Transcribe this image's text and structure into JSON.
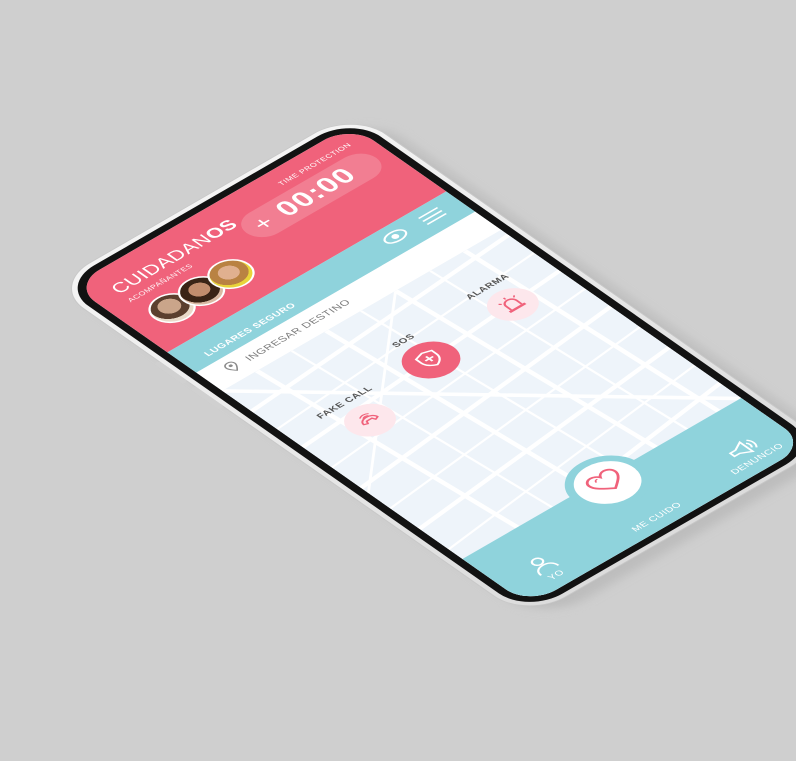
{
  "app": {
    "title_light": "CUIDADAN",
    "title_bold": "OS",
    "companions_label": "ACOMPAÑANTES"
  },
  "timer": {
    "label": "TIME PROTECTION",
    "plus": "+",
    "value": "00:00"
  },
  "places": {
    "title": "LUGARES SEGURO"
  },
  "search": {
    "placeholder": "INGRESAR DESTINO"
  },
  "actions": {
    "sos_label": "SOS",
    "alarm_label": "ALARMA",
    "fake_call_label": "FAKE CALL"
  },
  "nav": {
    "yo_label": "YO",
    "me_cuido_label": "ME CUIDO",
    "denuncio_label": "DENUNCIO"
  },
  "colors": {
    "brand_pink": "#f0627b",
    "brand_teal": "#8fd3dc",
    "map_bg": "#eef4fa"
  },
  "icons": {
    "eye": "eye-icon",
    "menu": "menu-icon",
    "pin": "location-pin-icon",
    "sos": "shield-plus-icon",
    "alarm": "siren-icon",
    "fake_call": "phone-call-icon",
    "heart": "heart-icon",
    "user": "user-icon",
    "megaphone": "megaphone-icon"
  }
}
